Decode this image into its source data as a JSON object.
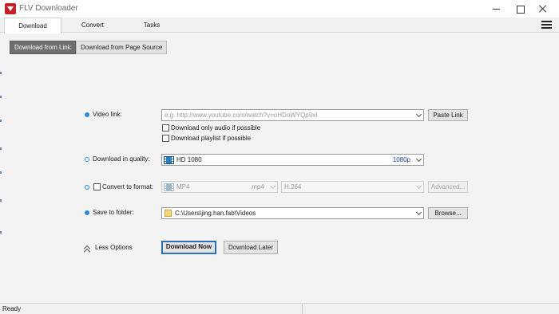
{
  "window": {
    "title": "FLV Downloader"
  },
  "tabs": [
    {
      "label": "Download"
    },
    {
      "label": "Convert"
    },
    {
      "label": "Tasks"
    }
  ],
  "subtabs": {
    "from_link": "Download from Link",
    "from_source": "Download from Page Source"
  },
  "form": {
    "video_link": {
      "label": "Video link:",
      "placeholder": "e.g. http://www.youtube.com/watch?v=oHDoWYQp9xI",
      "paste_button": "Paste Link"
    },
    "audio_only": {
      "label": "Download only audio if possible"
    },
    "playlist": {
      "label": "Download playlist if possible"
    },
    "quality": {
      "label": "Download in quality:",
      "value": "HD 1080",
      "resolution": "1080p"
    },
    "convert": {
      "label": "Convert to format:",
      "format": "MP4",
      "extension": ".mp4",
      "codec": "H.264",
      "advanced_button": "Advanced..."
    },
    "folder": {
      "label": "Save to folder:",
      "path": "C:\\Users\\jing.han.fab\\Videos",
      "browse_button": "Browse..."
    },
    "less_options": "Less Options",
    "download_now": "Download Now",
    "download_later": "Download Later"
  },
  "status": {
    "text": "Ready"
  },
  "colors": {
    "accent": "#2d8ad6",
    "brand": "#c8202a",
    "primary_border": "#2d6fb8",
    "resolution_text": "#1a3f99"
  },
  "icons": {
    "app": "download-arrow-icon",
    "menu": "hamburger-icon",
    "quality": "film-icon",
    "folder": "folder-icon",
    "less_options": "chevron-up-icon"
  }
}
